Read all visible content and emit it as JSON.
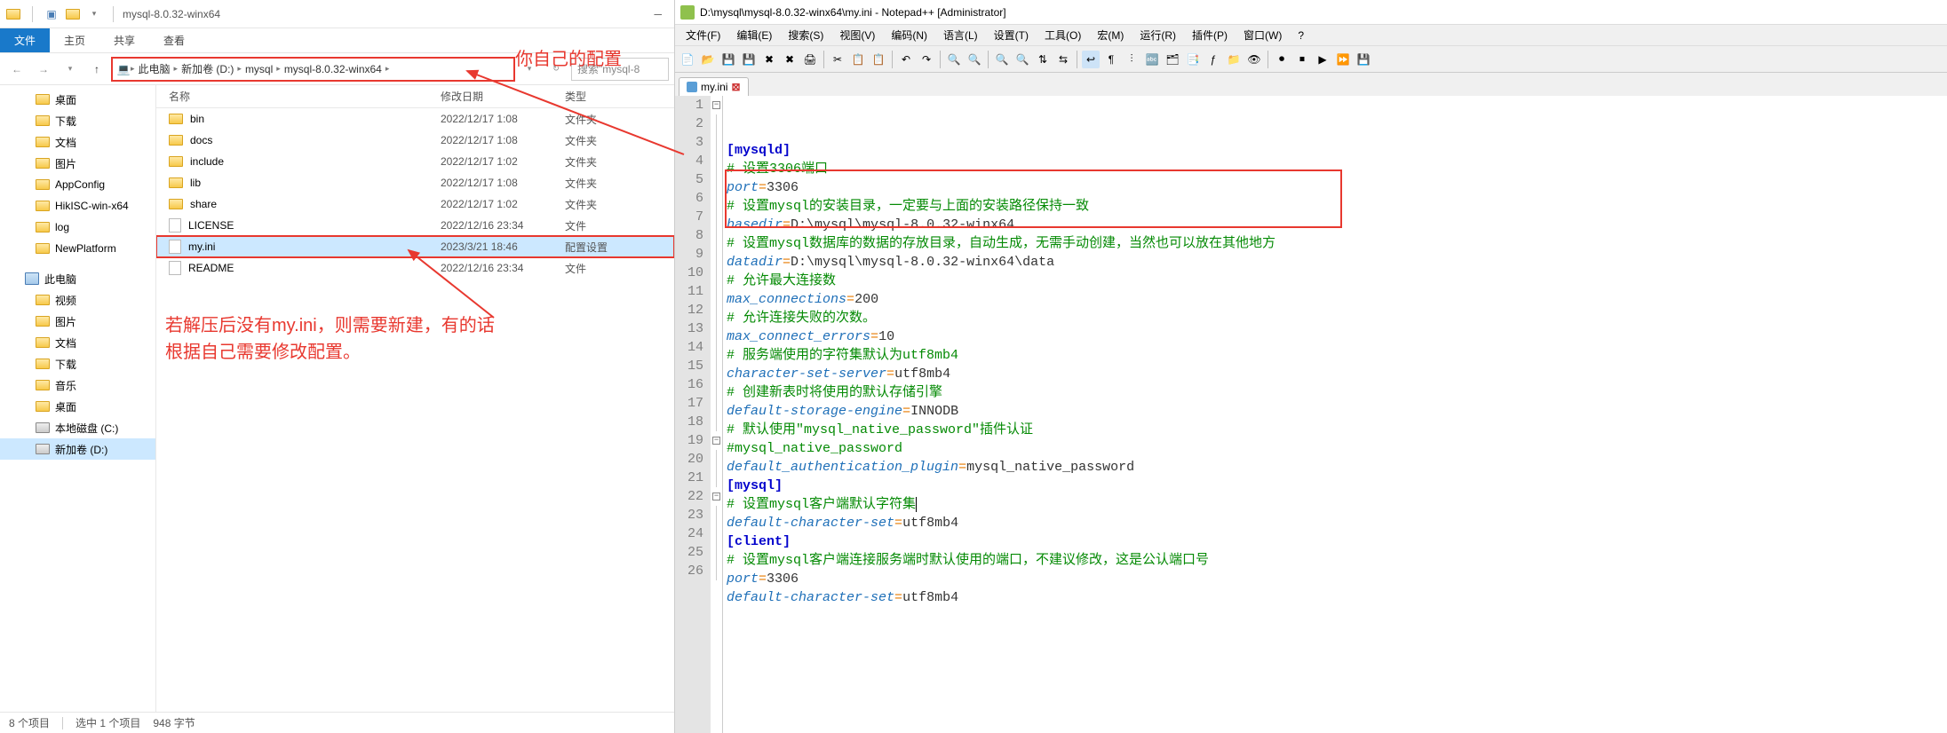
{
  "explorer": {
    "title": "mysql-8.0.32-winx64",
    "ribbon": {
      "file": "文件",
      "home": "主页",
      "share": "共享",
      "view": "查看"
    },
    "breadcrumb": [
      "此电脑",
      "新加卷 (D:)",
      "mysql",
      "mysql-8.0.32-winx64"
    ],
    "search_placeholder": "搜索\"mysql-8",
    "columns": {
      "name": "名称",
      "date": "修改日期",
      "type": "类型"
    },
    "tree": [
      {
        "label": "桌面",
        "icon": "folder"
      },
      {
        "label": "下载",
        "icon": "folder"
      },
      {
        "label": "文档",
        "icon": "folder"
      },
      {
        "label": "图片",
        "icon": "folder"
      },
      {
        "label": "AppConfig",
        "icon": "folder"
      },
      {
        "label": "HikISC-win-x64",
        "icon": "folder"
      },
      {
        "label": "log",
        "icon": "folder"
      },
      {
        "label": "NewPlatform",
        "icon": "folder"
      }
    ],
    "tree2_header": "此电脑",
    "tree2": [
      {
        "label": "视频",
        "icon": "folder"
      },
      {
        "label": "图片",
        "icon": "folder"
      },
      {
        "label": "文档",
        "icon": "folder"
      },
      {
        "label": "下载",
        "icon": "folder"
      },
      {
        "label": "音乐",
        "icon": "folder"
      },
      {
        "label": "桌面",
        "icon": "folder"
      },
      {
        "label": "本地磁盘 (C:)",
        "icon": "disk"
      },
      {
        "label": "新加卷 (D:)",
        "icon": "disk",
        "selected": true
      }
    ],
    "files": [
      {
        "name": "bin",
        "date": "2022/12/17 1:08",
        "type": "文件夹",
        "icon": "folder"
      },
      {
        "name": "docs",
        "date": "2022/12/17 1:08",
        "type": "文件夹",
        "icon": "folder"
      },
      {
        "name": "include",
        "date": "2022/12/17 1:02",
        "type": "文件夹",
        "icon": "folder"
      },
      {
        "name": "lib",
        "date": "2022/12/17 1:08",
        "type": "文件夹",
        "icon": "folder"
      },
      {
        "name": "share",
        "date": "2022/12/17 1:02",
        "type": "文件夹",
        "icon": "folder"
      },
      {
        "name": "LICENSE",
        "date": "2022/12/16 23:34",
        "type": "文件",
        "icon": "file"
      },
      {
        "name": "my.ini",
        "date": "2023/3/21 18:46",
        "type": "配置设置",
        "icon": "file",
        "selected": true
      },
      {
        "name": "README",
        "date": "2022/12/16 23:34",
        "type": "文件",
        "icon": "file"
      }
    ],
    "status": {
      "count": "8 个项目",
      "selected": "选中 1 个项目",
      "size": "948 字节"
    },
    "annotation_top": "你自己的配置",
    "annotation_body": "若解压后没有my.ini，则需要新建，有的话\n根据自己需要修改配置。"
  },
  "notepad": {
    "title": "D:\\mysql\\mysql-8.0.32-winx64\\my.ini - Notepad++ [Administrator]",
    "menu": [
      "文件(F)",
      "编辑(E)",
      "搜索(S)",
      "视图(V)",
      "编码(N)",
      "语言(L)",
      "设置(T)",
      "工具(O)",
      "宏(M)",
      "运行(R)",
      "插件(P)",
      "窗口(W)",
      "?"
    ],
    "tab": "my.ini",
    "lines": [
      {
        "n": 1,
        "fold": "minus",
        "seg": [
          {
            "c": "section",
            "t": "[mysqld]"
          }
        ]
      },
      {
        "n": 2,
        "seg": [
          {
            "c": "comment",
            "t": "# 设置3306端口"
          }
        ]
      },
      {
        "n": 3,
        "seg": [
          {
            "c": "key",
            "t": "port"
          },
          {
            "c": "op",
            "t": "="
          },
          {
            "c": "val",
            "t": "3306"
          }
        ]
      },
      {
        "n": 4,
        "seg": [
          {
            "c": "comment",
            "t": "# 设置mysql的安装目录，一定要与上面的安装路径保持一致"
          }
        ]
      },
      {
        "n": 5,
        "seg": [
          {
            "c": "key",
            "t": "basedir"
          },
          {
            "c": "op",
            "t": "="
          },
          {
            "c": "val",
            "t": "D:\\mysql\\mysql-8.0.32-winx64"
          }
        ]
      },
      {
        "n": 6,
        "seg": [
          {
            "c": "comment",
            "t": "# 设置mysql数据库的数据的存放目录，自动生成，无需手动创建，当然也可以放在其他地方"
          }
        ]
      },
      {
        "n": 7,
        "seg": [
          {
            "c": "key",
            "t": "datadir"
          },
          {
            "c": "op",
            "t": "="
          },
          {
            "c": "val",
            "t": "D:\\mysql\\mysql-8.0.32-winx64\\data"
          }
        ]
      },
      {
        "n": 8,
        "seg": [
          {
            "c": "comment",
            "t": "# 允许最大连接数"
          }
        ]
      },
      {
        "n": 9,
        "seg": [
          {
            "c": "key",
            "t": "max_connections"
          },
          {
            "c": "op",
            "t": "="
          },
          {
            "c": "val",
            "t": "200"
          }
        ]
      },
      {
        "n": 10,
        "seg": [
          {
            "c": "comment",
            "t": "# 允许连接失败的次数。"
          }
        ]
      },
      {
        "n": 11,
        "seg": [
          {
            "c": "key",
            "t": "max_connect_errors"
          },
          {
            "c": "op",
            "t": "="
          },
          {
            "c": "val",
            "t": "10"
          }
        ]
      },
      {
        "n": 12,
        "seg": [
          {
            "c": "comment",
            "t": "# 服务端使用的字符集默认为utf8mb4"
          }
        ]
      },
      {
        "n": 13,
        "seg": [
          {
            "c": "key",
            "t": "character-set-server"
          },
          {
            "c": "op",
            "t": "="
          },
          {
            "c": "val",
            "t": "utf8mb4"
          }
        ]
      },
      {
        "n": 14,
        "seg": [
          {
            "c": "comment",
            "t": "# 创建新表时将使用的默认存储引擎"
          }
        ]
      },
      {
        "n": 15,
        "seg": [
          {
            "c": "key",
            "t": "default-storage-engine"
          },
          {
            "c": "op",
            "t": "="
          },
          {
            "c": "val",
            "t": "INNODB"
          }
        ]
      },
      {
        "n": 16,
        "seg": [
          {
            "c": "comment",
            "t": "# 默认使用\"mysql_native_password\"插件认证"
          }
        ]
      },
      {
        "n": 17,
        "seg": [
          {
            "c": "comment",
            "t": "#mysql_native_password"
          }
        ]
      },
      {
        "n": 18,
        "seg": [
          {
            "c": "key",
            "t": "default_authentication_plugin"
          },
          {
            "c": "op",
            "t": "="
          },
          {
            "c": "val",
            "t": "mysql_native_password"
          }
        ]
      },
      {
        "n": 19,
        "fold": "minus",
        "seg": [
          {
            "c": "section",
            "t": "[mysql]"
          }
        ]
      },
      {
        "n": 20,
        "seg": [
          {
            "c": "comment",
            "t": "# 设置mysql客户端默认字符集"
          }
        ],
        "caret": true
      },
      {
        "n": 21,
        "seg": [
          {
            "c": "key",
            "t": "default-character-set"
          },
          {
            "c": "op",
            "t": "="
          },
          {
            "c": "val",
            "t": "utf8mb4"
          }
        ]
      },
      {
        "n": 22,
        "fold": "minus",
        "seg": [
          {
            "c": "section",
            "t": "[client]"
          }
        ]
      },
      {
        "n": 23,
        "seg": [
          {
            "c": "comment",
            "t": "# 设置mysql客户端连接服务端时默认使用的端口，不建议修改，这是公认端口号"
          }
        ]
      },
      {
        "n": 24,
        "seg": [
          {
            "c": "key",
            "t": "port"
          },
          {
            "c": "op",
            "t": "="
          },
          {
            "c": "val",
            "t": "3306"
          }
        ]
      },
      {
        "n": 25,
        "seg": [
          {
            "c": "key",
            "t": "default-character-set"
          },
          {
            "c": "op",
            "t": "="
          },
          {
            "c": "val",
            "t": "utf8mb4"
          }
        ]
      },
      {
        "n": 26,
        "seg": []
      }
    ]
  }
}
